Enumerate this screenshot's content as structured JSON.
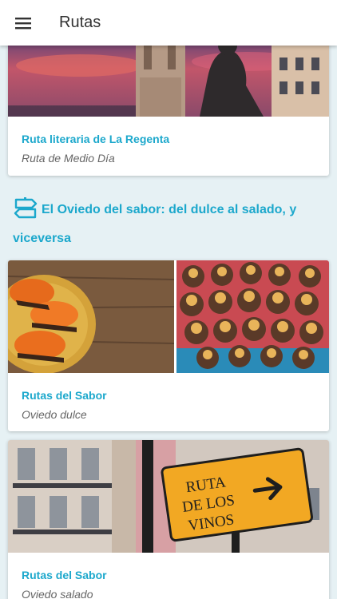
{
  "app": {
    "title": "Rutas",
    "menu_icon": "hamburger-menu-icon"
  },
  "colors": {
    "accent": "#1ca8cc",
    "background": "#e6f1f4",
    "subtitle": "#666666"
  },
  "cards": [
    {
      "title": "Ruta literaria de La Regenta",
      "subtitle": "Ruta de Medio Día",
      "image": "cathedral-statue-sunset-image"
    },
    {
      "title": "Rutas del Sabor",
      "subtitle": "Oviedo dulce",
      "image": "pastries-and-chocolates-image"
    },
    {
      "title": "Rutas del Sabor",
      "subtitle": "Oviedo salado",
      "image": "ruta-de-los-vinos-sign-image"
    }
  ],
  "section": {
    "title": "El Oviedo del sabor: del dulce al salado, y viceversa",
    "icon": "signpost-icon"
  },
  "sign": {
    "line1": "RUTA",
    "line2": "DE LOS",
    "line3": "VINOS"
  }
}
